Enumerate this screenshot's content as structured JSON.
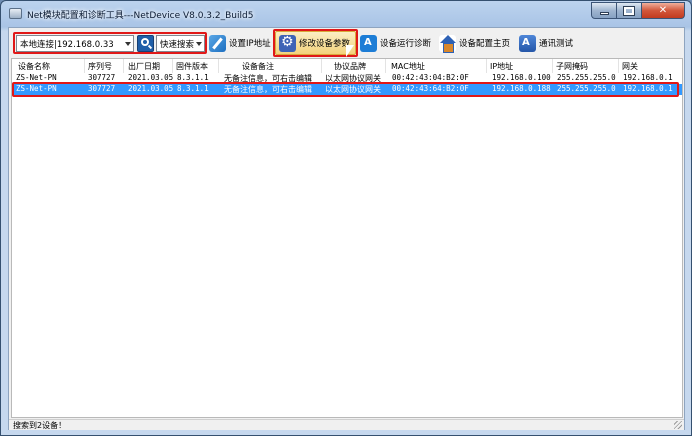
{
  "window": {
    "title": "Net模块配置和诊断工具---NetDevice V8.0.3.2_Build5"
  },
  "toolbar": {
    "connection_value": "本地连接|192.168.0.33",
    "search_mode_value": "快速搜索",
    "buttons": [
      {
        "label": "设置IP地址",
        "icon": "pen-icon"
      },
      {
        "label": "修改设备参数",
        "icon": "gear-icon"
      },
      {
        "label": "设备运行诊断",
        "icon": "app-store-icon"
      },
      {
        "label": "设备配置主页",
        "icon": "home-icon"
      },
      {
        "label": "通讯测试",
        "icon": "app-icon"
      }
    ]
  },
  "table": {
    "columns": [
      "设备名称",
      "序列号",
      "出厂日期",
      "固件版本",
      "设备备注",
      "协议品牌",
      "MAC地址",
      "IP地址",
      "子网掩码",
      "网关"
    ],
    "rows": [
      [
        "ZS-Net-PN",
        "307727",
        "2021.03.05",
        "8.3.1.1",
        "无备注信息，可右击编辑",
        "以太网协议网关",
        "00:42:43:04:B2:0F",
        "192.168.0.100",
        "255.255.255.0",
        "192.168.0.1"
      ],
      [
        "ZS-Net-PN",
        "307727",
        "2021.03.05",
        "8.3.1.1",
        "无备注信息，可右击编辑",
        "以太网协议网关",
        "00:42:43:64:B2:0F",
        "192.168.0.188",
        "255.255.255.0",
        "192.168.0.1"
      ]
    ],
    "selected_row": 1
  },
  "status": {
    "text": "搜索到2设备！"
  },
  "colors": {
    "highlight_box": "#e01818",
    "selection": "#3399ff"
  }
}
